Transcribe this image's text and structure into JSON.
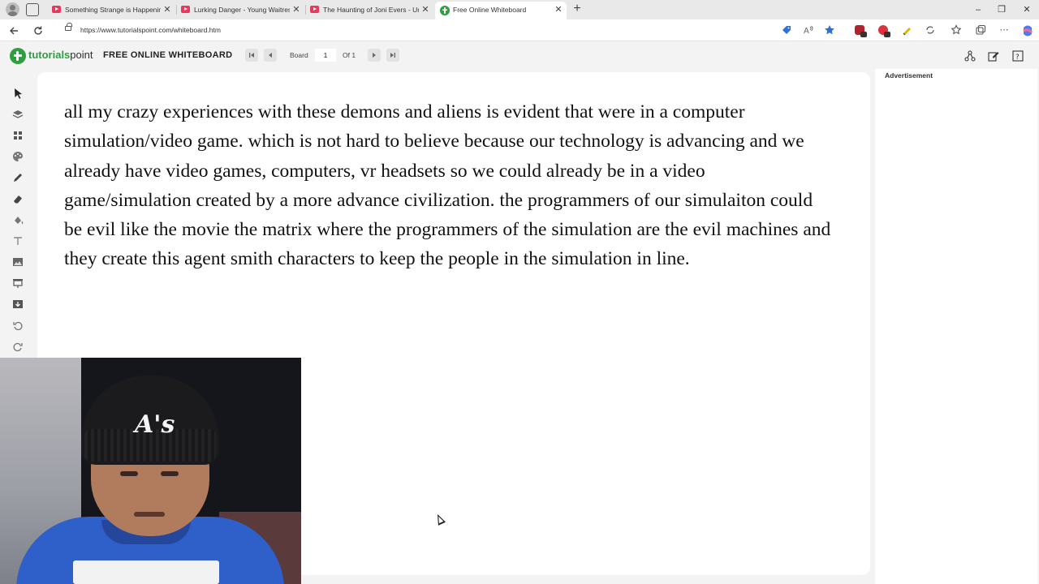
{
  "browser": {
    "tabs": [
      {
        "title": "Something Strange is Happening",
        "active": false
      },
      {
        "title": "Lurking Danger - Young Waitress",
        "active": false
      },
      {
        "title": "The Haunting of Joni Evers - Unex",
        "active": false
      },
      {
        "title": "Free Online Whiteboard",
        "active": true
      }
    ],
    "new_tab_glyph": "+",
    "window_controls": {
      "minimize": "–",
      "restore": "❐",
      "close": "✕"
    },
    "url": "https://www.tutorialspoint.com/whiteboard.htm"
  },
  "site": {
    "logo_text_brand": "tutorials",
    "logo_text_rest": "point",
    "title": "FREE ONLINE WHITEBOARD",
    "board_label": "Board",
    "board_number": "1",
    "of_label": "Of 1",
    "advertisement_label": "Advertisement"
  },
  "board": {
    "text": "all my crazy experiences with these demons and aliens is evident that were in a computer simulation/video game. which is not hard to believe because our technology is advancing and we already have video games, computers, vr headsets so we could already be in a video game/simulation created by a more advance civilization. the programmers of our simulaiton could be evil like the movie the matrix where the programmers of the simulation are the evil machines and they create this agent smith characters to keep the people in the simulation in line."
  },
  "webcam": {
    "cap_logo": "A's"
  },
  "colors": {
    "brand_green": "#2e9e3f",
    "youtube_red": "#e8385b",
    "shirt_blue": "#2f5fc8"
  }
}
